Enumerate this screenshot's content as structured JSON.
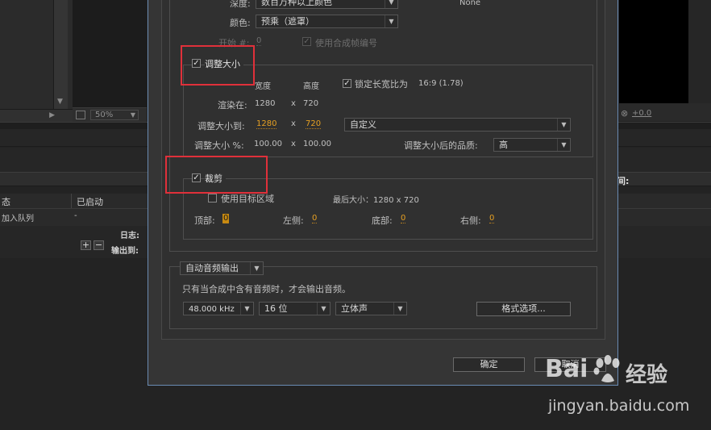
{
  "background": {
    "zoom_value": "50%",
    "exposure_value": "+0.0",
    "right_header_label": "间:",
    "table_headers": [
      "态",
      "已启动"
    ],
    "table_row": [
      "加入队列",
      "-"
    ],
    "log_label": "日志:",
    "output_label": "输出到:"
  },
  "dialog": {
    "depth_label": "深度:",
    "depth_value": "数百万种以上颜色",
    "color_label": "颜色:",
    "color_value": "预乘（遮罩）",
    "none_text": "None",
    "start_label": "开始 #:",
    "start_value": "0",
    "use_comp_frame": "使用合成帧编号",
    "resize": {
      "title": "调整大小",
      "width_header": "宽度",
      "height_header": "高度",
      "lock_aspect": "锁定长宽比为",
      "aspect_value": "16:9 (1.78)",
      "render_at_label": "渲染在:",
      "render_w": "1280",
      "render_h": "720",
      "resize_to_label": "调整大小到:",
      "resize_w": "1280",
      "resize_h": "720",
      "preset": "自定义",
      "percent_label": "调整大小 %:",
      "pct_w": "100.00",
      "pct_h": "100.00",
      "quality_label": "调整大小后的品质:",
      "quality_value": "高",
      "x": "x"
    },
    "crop": {
      "title": "裁剪",
      "use_roi": "使用目标区域",
      "final_size": "最后大小：1280 x 720",
      "top_label": "顶部:",
      "top_value": "0",
      "left_label": "左侧:",
      "left_value": "0",
      "bottom_label": "底部:",
      "bottom_value": "0",
      "right_label": "右侧:",
      "right_value": "0"
    },
    "audio": {
      "mode": "自动音频输出",
      "note": "只有当合成中含有音频时，才会输出音频。",
      "rate": "48.000 kHz",
      "bits": "16 位",
      "channels": "立体声",
      "format_options": "格式选项..."
    },
    "ok": "确定",
    "cancel": "取消"
  },
  "watermark": {
    "brand_left": "Bai",
    "brand_right": "经验",
    "url": "jingyan.baidu.com"
  },
  "colors": {
    "highlight": "#e0303a",
    "value_orange": "#e6a022",
    "dialog_border": "#6a8bb3"
  }
}
